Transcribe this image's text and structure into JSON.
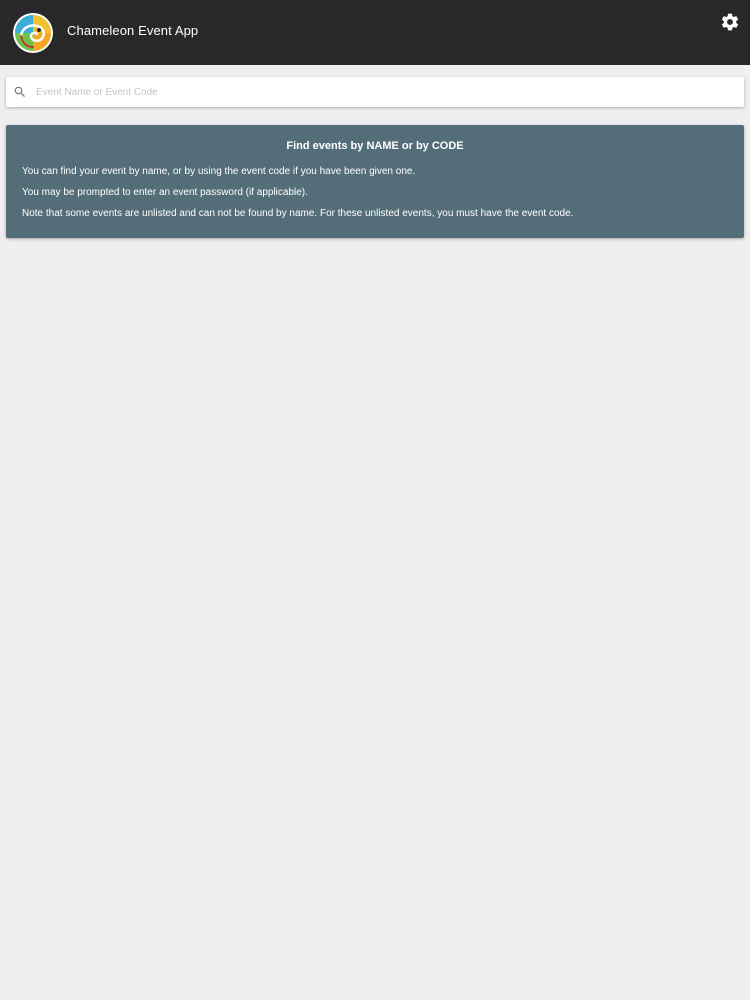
{
  "app_bar": {
    "title": "Chameleon Event App",
    "logo_icon": "chameleon-logo-icon",
    "settings_icon": "gear-icon",
    "background": "#28282b"
  },
  "search": {
    "placeholder": "Event Name or Event Code",
    "value": "",
    "icon": "search-icon"
  },
  "info_card": {
    "heading": "Find events by NAME or by CODE",
    "lines": [
      "You can find your event by name, or by using the event code if you have been given one.",
      "You may be prompted to enter an event password (if applicable).",
      "Note that some events are unlisted and can not be found by name. For these unlisted events, you must have the event code."
    ],
    "background": "#546e79"
  },
  "colors": {
    "page_background": "#efeff0",
    "logo_green": "#5cb85c",
    "logo_yellow": "#f2c12e"
  }
}
